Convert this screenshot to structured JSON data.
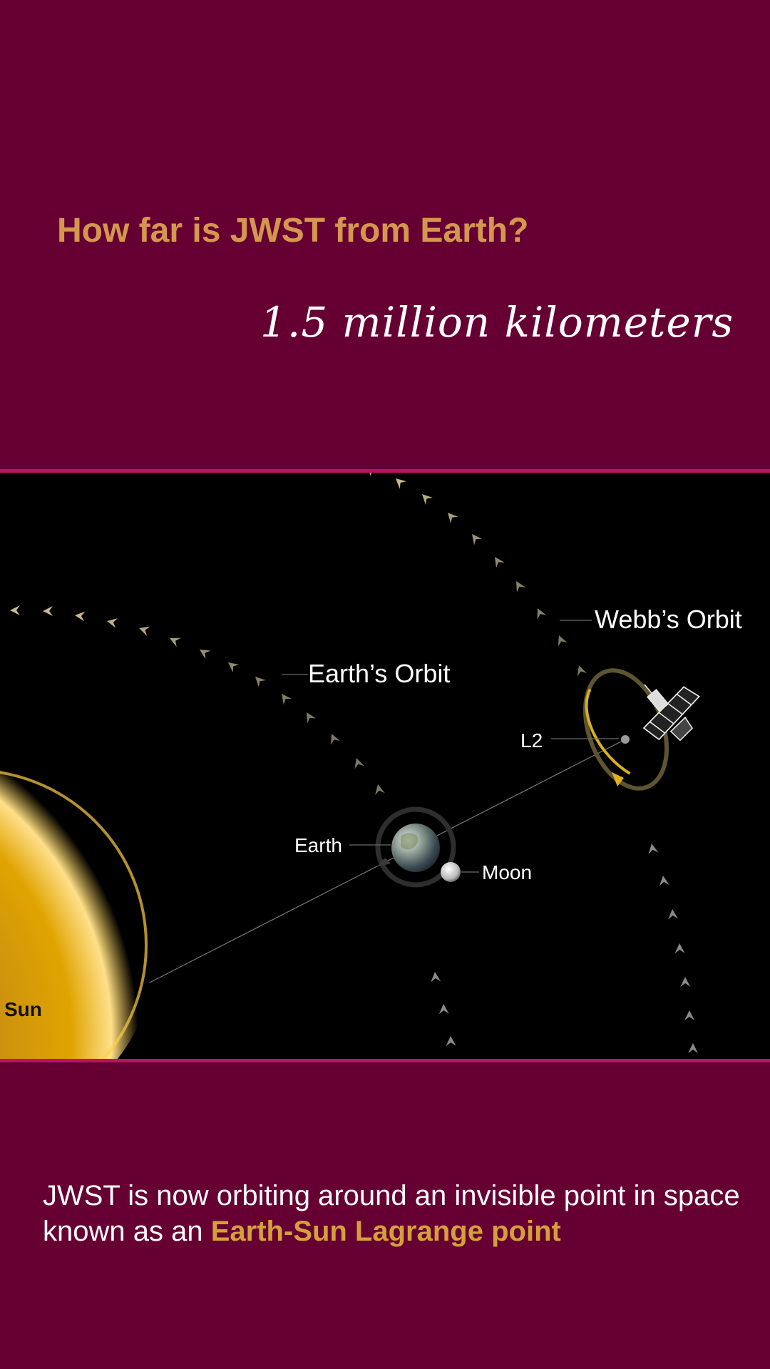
{
  "header": {
    "question": "How far is JWST from Earth?",
    "answer": "1.5 million kilometers"
  },
  "diagram": {
    "labels": {
      "webbs_orbit": "Webb’s Orbit",
      "earths_orbit": "Earth’s Orbit",
      "l2": "L2",
      "earth": "Earth",
      "moon": "Moon",
      "sun": "Sun"
    },
    "colors": {
      "background": "#000000",
      "sun": "#e0a400",
      "orbit_arrows_near": "#c9b98a",
      "orbit_arrows_far": "#8a8a8a",
      "halo_orbit": "#d8b020"
    }
  },
  "footer": {
    "caption_prefix": "JWST is now orbiting around an invisible point in space known as an ",
    "caption_highlight": "Earth-Sun Lagrange point"
  },
  "theme": {
    "background": "#660033",
    "separator": "#b81463",
    "question_color": "#d4974e",
    "highlight_color": "#d4a03a"
  }
}
